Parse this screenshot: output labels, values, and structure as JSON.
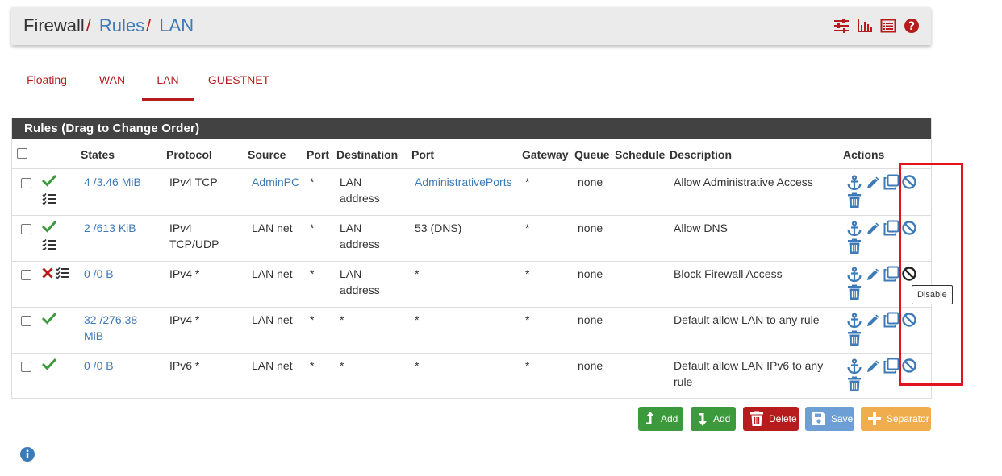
{
  "breadcrumb": {
    "items": [
      "Firewall",
      "Rules",
      "LAN"
    ],
    "separator": "/"
  },
  "header_icons": [
    "sliders-icon",
    "bar-chart-icon",
    "list-icon",
    "help-icon"
  ],
  "tabs": [
    {
      "label": "Floating",
      "active": false
    },
    {
      "label": "WAN",
      "active": false
    },
    {
      "label": "LAN",
      "active": true
    },
    {
      "label": "GUESTNET",
      "active": false
    }
  ],
  "panel": {
    "title": "Rules (Drag to Change Order)",
    "columns": [
      "States",
      "Protocol",
      "Source",
      "Port",
      "Destination",
      "Port",
      "Gateway",
      "Queue",
      "Schedule",
      "Description",
      "Actions"
    ]
  },
  "rules": [
    {
      "status": "pass",
      "states": "4 /3.46 MiB",
      "protocol": "IPv4 TCP",
      "source": "AdminPC",
      "source_link": true,
      "source_port": "*",
      "destination": "LAN address",
      "dest_port": "AdministrativePorts",
      "dest_port_link": true,
      "gateway": "*",
      "queue": "none",
      "schedule": "",
      "description": "Allow Administrative Access"
    },
    {
      "status": "pass",
      "states": "2 /613 KiB",
      "protocol": "IPv4 TCP/UDP",
      "source": "LAN net",
      "source_link": false,
      "source_port": "*",
      "destination": "LAN address",
      "dest_port": "53 (DNS)",
      "dest_port_link": false,
      "gateway": "*",
      "queue": "none",
      "schedule": "",
      "description": "Allow DNS"
    },
    {
      "status": "block",
      "states": "0 /0 B",
      "protocol": "IPv4 *",
      "source": "LAN net",
      "source_link": false,
      "source_port": "*",
      "destination": "LAN address",
      "dest_port": "*",
      "dest_port_link": false,
      "gateway": "*",
      "queue": "none",
      "schedule": "",
      "description": "Block Firewall Access"
    },
    {
      "status": "pass",
      "states": "32 /276.38 MiB",
      "protocol": "IPv4 *",
      "source": "LAN net",
      "source_link": false,
      "source_port": "*",
      "destination": "*",
      "dest_port": "*",
      "dest_port_link": false,
      "gateway": "*",
      "queue": "none",
      "schedule": "",
      "description": "Default allow LAN to any rule"
    },
    {
      "status": "pass",
      "states": "0 /0 B",
      "protocol": "IPv6 *",
      "source": "LAN net",
      "source_link": false,
      "source_port": "*",
      "destination": "*",
      "dest_port": "*",
      "dest_port_link": false,
      "gateway": "*",
      "queue": "none",
      "schedule": "",
      "description": "Default allow LAN IPv6 to any rule"
    }
  ],
  "row_action_icons": [
    "anchor-icon",
    "pencil-icon",
    "copy-icon",
    "disable-icon",
    "trash-icon"
  ],
  "tooltip": "Disable",
  "buttons": [
    {
      "label": "Add",
      "color": "#3c9a3c",
      "icon": "arrow-up-icon"
    },
    {
      "label": "Add",
      "color": "#3c9a3c",
      "icon": "arrow-down-icon"
    },
    {
      "label": "Delete",
      "color": "#b71c1c",
      "icon": "trash-icon"
    },
    {
      "label": "Save",
      "color": "#6d9fd4",
      "icon": "save-icon"
    },
    {
      "label": "Separator",
      "color": "#f0ad4e",
      "icon": "plus-icon"
    }
  ],
  "colors": {
    "accent_red": "#b71c1c",
    "link_blue": "#3d7ab8",
    "pass_green": "#3c9a3c",
    "block_red": "#b71c1c",
    "panel_header": "#424242",
    "highlight": "#e0131f"
  }
}
